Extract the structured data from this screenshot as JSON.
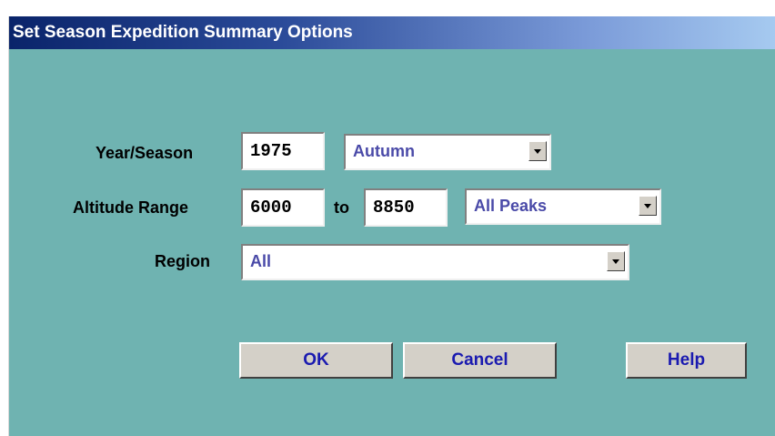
{
  "dialog": {
    "title": "Set Season Expedition Summary Options"
  },
  "form": {
    "year_season_label": "Year/Season",
    "year_value": "1975",
    "season_value": "Autumn",
    "altitude_range_label": "Altitude Range",
    "altitude_min_value": "6000",
    "to_label": "to",
    "altitude_max_value": "8850",
    "peaks_value": "All Peaks",
    "region_label": "Region",
    "region_value": "All"
  },
  "buttons": {
    "ok": "OK",
    "cancel": "Cancel",
    "help": "Help"
  },
  "colors": {
    "dialog_background": "#6fb3b1",
    "title_text": "#ffffff",
    "combo_text": "#4a4aa8",
    "button_text": "#1a1ab0"
  },
  "icons": {
    "dropdown": "chevron-down-icon"
  }
}
